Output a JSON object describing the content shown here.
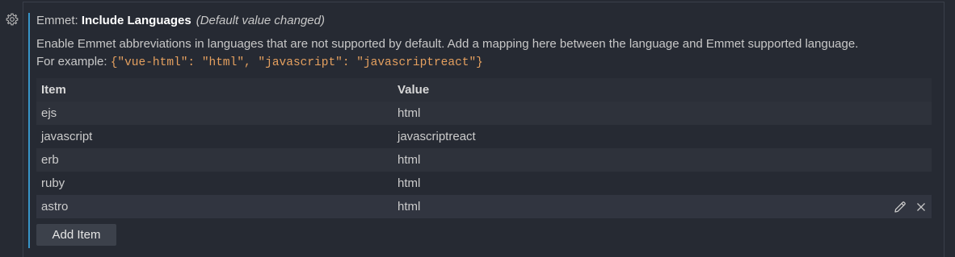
{
  "setting": {
    "category": "Emmet: ",
    "name": "Include Languages",
    "modified_note": "(Default value changed)",
    "description_line1": "Enable Emmet abbreviations in languages that are not supported by default. Add a mapping here between the language and Emmet supported language.",
    "description_prefix": "For example: ",
    "description_example": "{\"vue-html\": \"html\", \"javascript\": \"javascriptreact\"}"
  },
  "table": {
    "header_item": "Item",
    "header_value": "Value",
    "rows": [
      {
        "item": "ejs",
        "value": "html"
      },
      {
        "item": "javascript",
        "value": "javascriptreact"
      },
      {
        "item": "erb",
        "value": "html"
      },
      {
        "item": "ruby",
        "value": "html"
      },
      {
        "item": "astro",
        "value": "html"
      }
    ]
  },
  "add_button_label": "Add Item",
  "icons": {
    "gear": "gear-icon",
    "edit": "pencil-icon",
    "remove": "close-icon"
  },
  "colors": {
    "background": "#262A33",
    "accent": "#3794C8",
    "example_code": "#E5A05F"
  }
}
